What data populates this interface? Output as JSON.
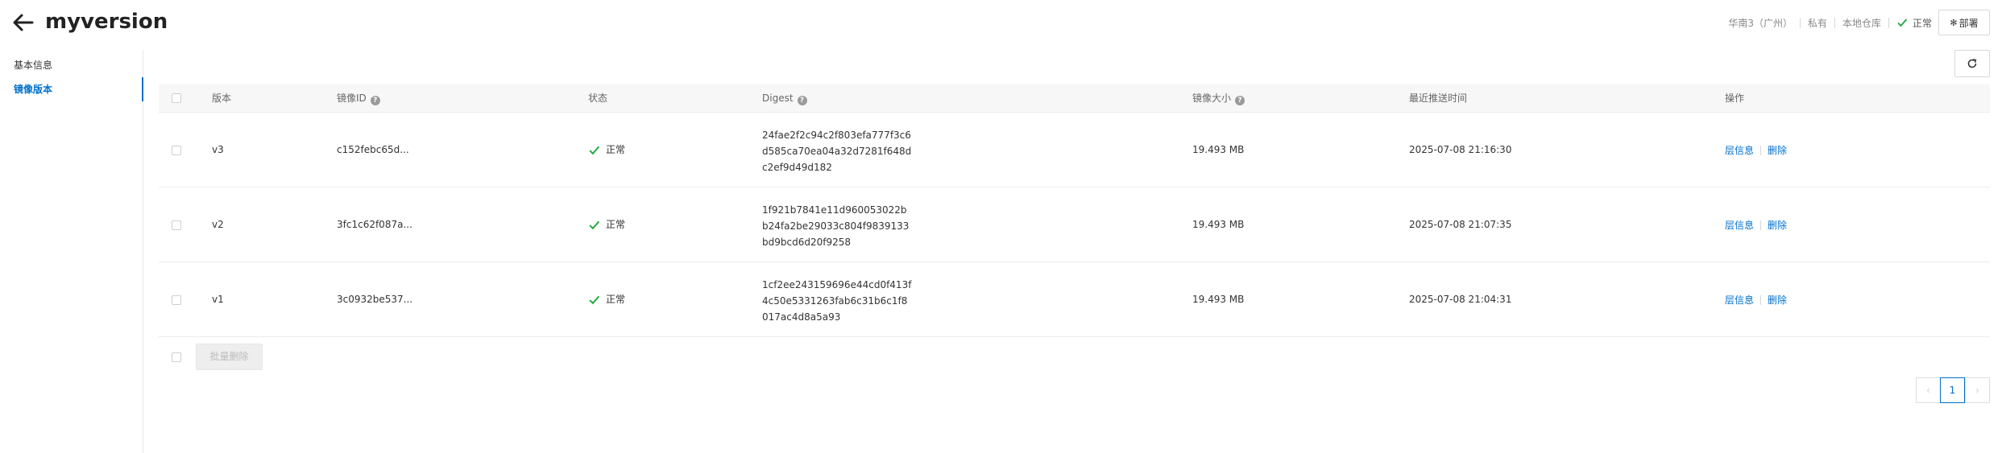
{
  "header": {
    "title": "myversion",
    "region": "华南3（广州）",
    "visibility": "私有",
    "repo_type": "本地仓库",
    "status": "正常",
    "deploy_label": "部署",
    "deploy_icon": "gear-icon"
  },
  "sidebar": {
    "items": [
      {
        "label": "基本信息",
        "active": false
      },
      {
        "label": "镜像版本",
        "active": true
      }
    ]
  },
  "table": {
    "columns": {
      "version": "版本",
      "image_id": "镜像ID",
      "status": "状态",
      "digest": "Digest",
      "size": "镜像大小",
      "pushed": "最近推送时间",
      "ops": "操作"
    },
    "rows": [
      {
        "version": "v3",
        "image_id": "c152febc65d...",
        "status": "正常",
        "digest": [
          "24fae2f2c94c2f803efa777f3c6",
          "d585ca70ea04a32d7281f648d",
          "c2ef9d49d182"
        ],
        "size": "19.493 MB",
        "pushed": "2025-07-08 21:16:30",
        "op_layers": "层信息",
        "op_delete": "删除"
      },
      {
        "version": "v2",
        "image_id": "3fc1c62f087a...",
        "status": "正常",
        "digest": [
          "1f921b7841e11d960053022b",
          "b24fa2be29033c804f9839133",
          "bd9bcd6d20f9258"
        ],
        "size": "19.493 MB",
        "pushed": "2025-07-08 21:07:35",
        "op_layers": "层信息",
        "op_delete": "删除"
      },
      {
        "version": "v1",
        "image_id": "3c0932be537...",
        "status": "正常",
        "digest": [
          "1cf2ee243159696e44cd0f413f",
          "4c50e5331263fab6c31b6c1f8",
          "017ac4d8a5a93"
        ],
        "size": "19.493 MB",
        "pushed": "2025-07-08 21:04:31",
        "op_layers": "层信息",
        "op_delete": "删除"
      }
    ],
    "batch_delete_label": "批量删除"
  },
  "pagination": {
    "current": "1"
  },
  "colors": {
    "link": "#0070cc",
    "success": "#1fa83b"
  }
}
